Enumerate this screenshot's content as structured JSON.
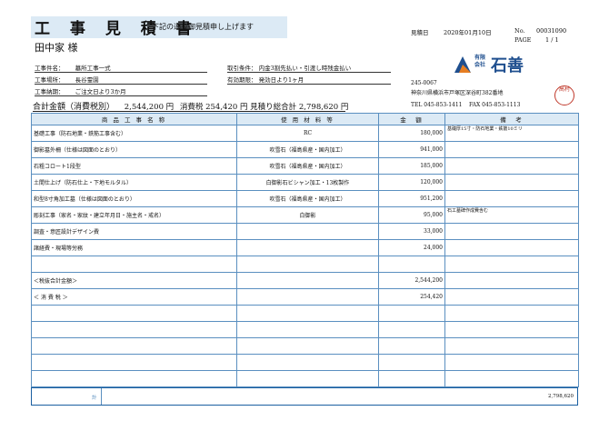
{
  "header": {
    "title": "工 事 見 積 書",
    "subtitle": "下記の通り御見積申し上げます",
    "client": "田中家 様",
    "date_label": "見積日",
    "date": "2020年01月10日",
    "no_label": "No.",
    "no": "00031090",
    "page_label": "PAGE",
    "page": "1 / 1"
  },
  "info": {
    "work_name_label": "工事件名：",
    "work_name": "墓所工事一式",
    "work_place_label": "工事場所：",
    "work_place": "長谷霊園",
    "period_label": "工事納期：",
    "period": "ご注文日より3か月",
    "terms_label": "取引条件：",
    "terms": "内金3割先払い・引渡し時残金払い",
    "valid_label": "有効期限：",
    "valid": "発効日より1ヶ月"
  },
  "total": {
    "label": "合計金額（消費税別）",
    "amount": "2,544,200 円",
    "tax_label": "消費税",
    "tax": "254,420 円",
    "grand_label": "見積り総合計",
    "grand": "2,798,620 円"
  },
  "company": {
    "kaisha_1": "有限",
    "kaisha_2": "会社",
    "name": "石善",
    "postal": "245-0067",
    "address": "神奈川県横浜市戸塚区深谷町382番地",
    "tel": "TEL 045-853-1411",
    "fax": "FAX 045-853-1113",
    "stamp": "高村"
  },
  "table": {
    "headers": [
      "商 品 工 事 名 称",
      "使 用 材 料 等",
      "金　額",
      "備　考"
    ],
    "rows": [
      {
        "name": "基礎工事（防石地業・鉄筋工事含む）",
        "material": "RC",
        "amount": "180,000",
        "note": "基礎厚15寸・防石地業・鉄筋10ミリ"
      },
      {
        "name": "御影墓外柵（仕様は図面のとおり）",
        "material": "吹雪石（福島県産・国内加工）",
        "amount": "941,000",
        "note": ""
      },
      {
        "name": "石粗コロート1段型",
        "material": "吹雪石（福島県産・国内加工）",
        "amount": "185,000",
        "note": ""
      },
      {
        "name": "土間仕上げ（防石仕上・下地モルタル）",
        "material": "白御影石ビシャン加工・13枚製作",
        "amount": "120,000",
        "note": ""
      },
      {
        "name": "和型8寸角加工墓（仕様は図面のとおり）",
        "material": "吹雪石（福島県産・国内加工）",
        "amount": "951,200",
        "note": ""
      },
      {
        "name": "彫刻工事（家名・家紋・建立年月日・施主名・戒名）",
        "material": "白御影",
        "amount": "95,000",
        "note": "石工墓碑作成費含む"
      },
      {
        "name": "調査・意匠設計デザイン費",
        "material": "",
        "amount": "33,000",
        "note": ""
      },
      {
        "name": "諸経費・現場等労務",
        "material": "",
        "amount": "24,000",
        "note": ""
      },
      {
        "name": "",
        "material": "",
        "amount": "",
        "note": ""
      },
      {
        "name": "＜税抜合計金額＞",
        "material": "",
        "amount": "2,544,200",
        "note": ""
      },
      {
        "name": "＜ 消 費 税 ＞",
        "material": "",
        "amount": "254,420",
        "note": ""
      },
      {
        "name": "",
        "material": "",
        "amount": "",
        "note": ""
      },
      {
        "name": "",
        "material": "",
        "amount": "",
        "note": ""
      },
      {
        "name": "",
        "material": "",
        "amount": "",
        "note": ""
      },
      {
        "name": "",
        "material": "",
        "amount": "",
        "note": ""
      },
      {
        "name": "",
        "material": "",
        "amount": "",
        "note": ""
      }
    ]
  },
  "footer": {
    "label": "計",
    "total": "2,798,620"
  }
}
